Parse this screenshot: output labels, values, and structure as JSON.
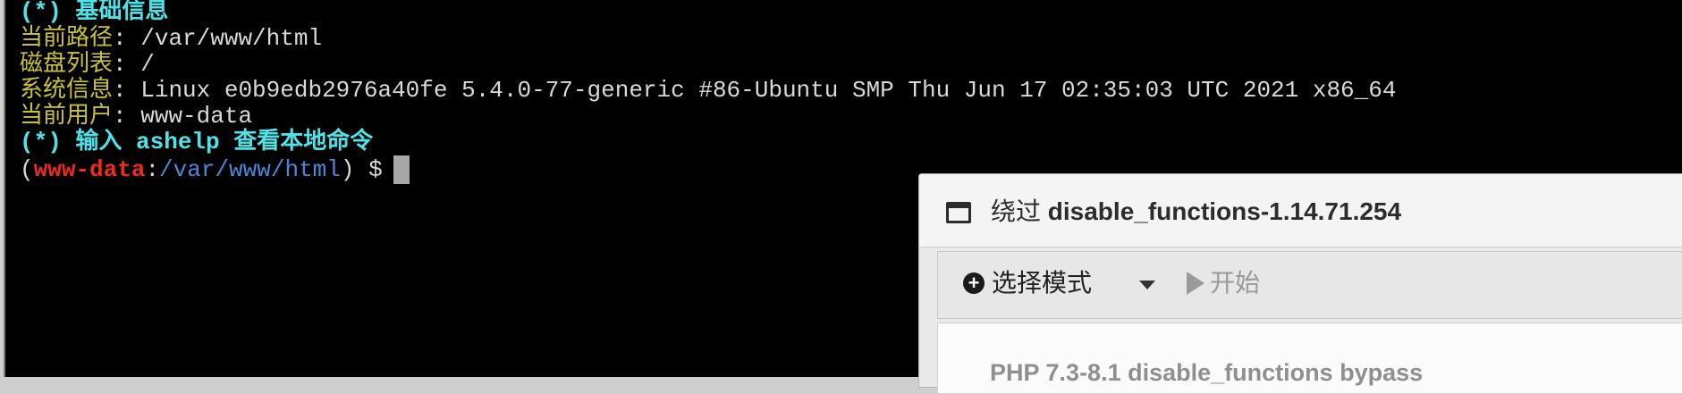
{
  "terminal": {
    "header_line": "(*) 基础信息",
    "info": [
      {
        "label": "当前路径",
        "value": "/var/www/html"
      },
      {
        "label": "磁盘列表",
        "value": "/"
      },
      {
        "label": "系统信息",
        "value": "Linux e0b9edb2976a40fe 5.4.0-77-generic #86-Ubuntu SMP Thu Jun 17 02:35:03 UTC 2021 x86_64"
      },
      {
        "label": "当前用户",
        "value": "www-data"
      }
    ],
    "separator": ": ",
    "help_prefix": "(*) 输入 ",
    "help_command": "ashelp",
    "help_suffix": " 查看本地命令",
    "prompt": {
      "open": "(",
      "user": "www-data",
      "colon": ":",
      "path": "/var/www/html",
      "close": ") $"
    }
  },
  "dialog": {
    "title_prefix": "绕过 ",
    "title_main": "disable_functions-1.14.71.254",
    "toolbar": {
      "select_mode_label": "选择模式",
      "start_label": "开始"
    },
    "panel_heading": "PHP 7.3-8.1 disable_functions bypass"
  },
  "icons": {
    "window": "window-icon",
    "plus": "plus-circle-icon",
    "caret": "caret-down-icon",
    "play": "play-icon"
  },
  "colors": {
    "terminal_bg": "#000000",
    "cyan": "#4fe3e8",
    "label_yellow": "#c8c23a",
    "user_red": "#ee2a1a",
    "path_blue": "#4a87d6"
  }
}
